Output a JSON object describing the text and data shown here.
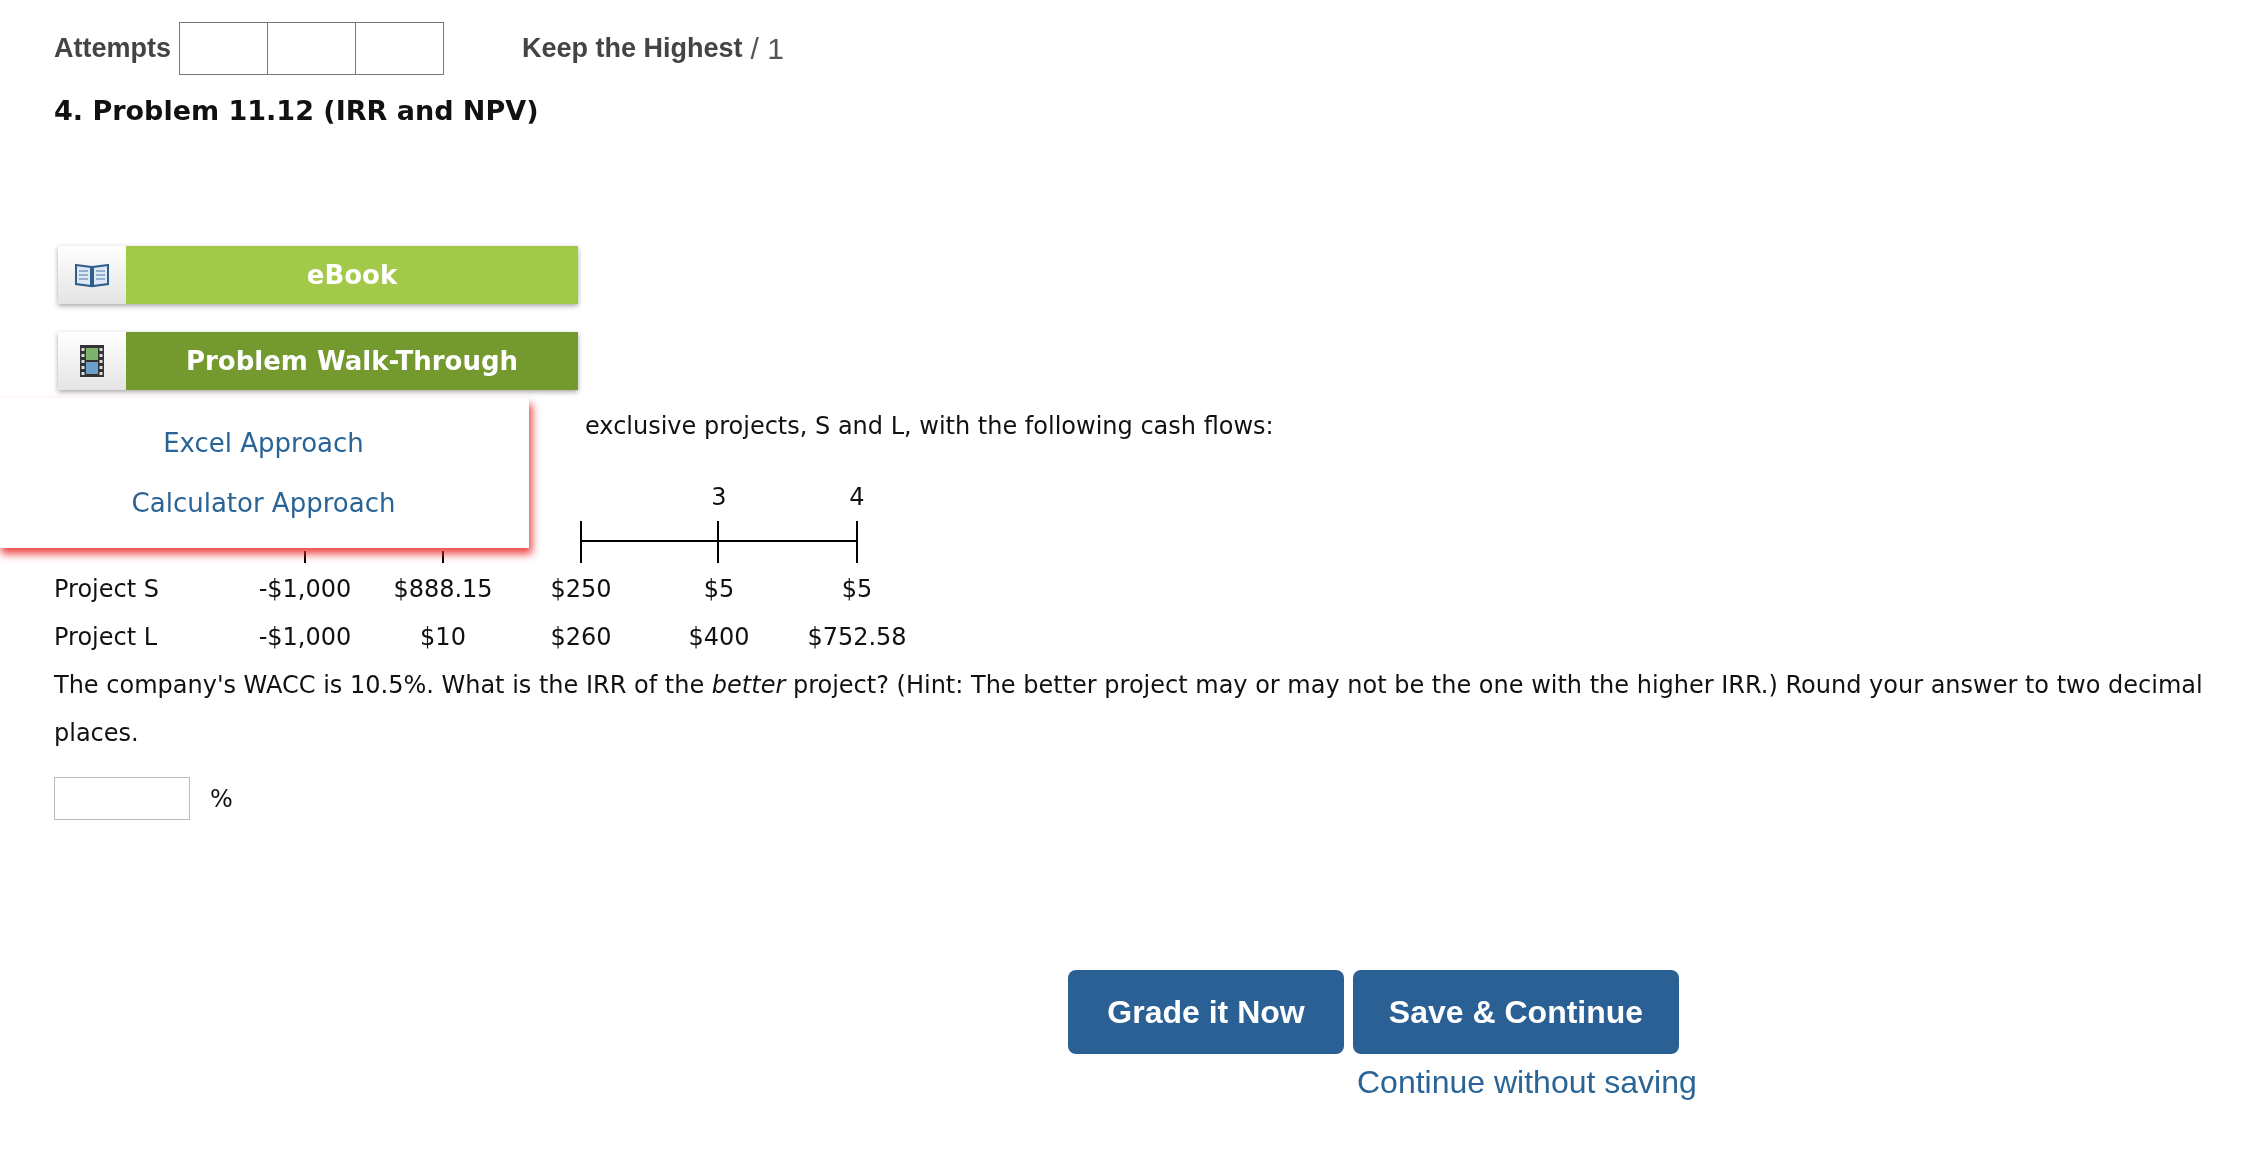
{
  "header": {
    "attempts_label": "Attempts",
    "keep_rule": "Keep the Highest",
    "score": "/ 1"
  },
  "problem_title": "4.  Problem 11.12 (IRR and NPV)",
  "resources": [
    {
      "kind": "book",
      "label": "eBook"
    },
    {
      "kind": "film",
      "label": "Problem Walk-Through"
    }
  ],
  "walkthrough_menu": [
    "Excel Approach",
    "Calculator Approach"
  ],
  "intro_visible": "exclusive projects, S and L, with the following cash flows:",
  "timeline": {
    "periods": [
      "3",
      "4"
    ],
    "rows": [
      {
        "name": "Project S",
        "flows": [
          "-$1,000",
          "$888.15",
          "$250",
          "$5",
          "$5"
        ]
      },
      {
        "name": "Project L",
        "flows": [
          "-$1,000",
          "$10",
          "$260",
          "$400",
          "$752.58"
        ]
      }
    ]
  },
  "question": "The company's WACC is 10.5%. What is the IRR of the *better* project? (Hint: The better project may or may not be the one with the higher IRR.) Round your answer to two decimal places.",
  "answer": {
    "unit": "%"
  },
  "buttons": [
    "Grade it Now",
    "Save & Continue"
  ],
  "skip_link": "Continue without saving"
}
